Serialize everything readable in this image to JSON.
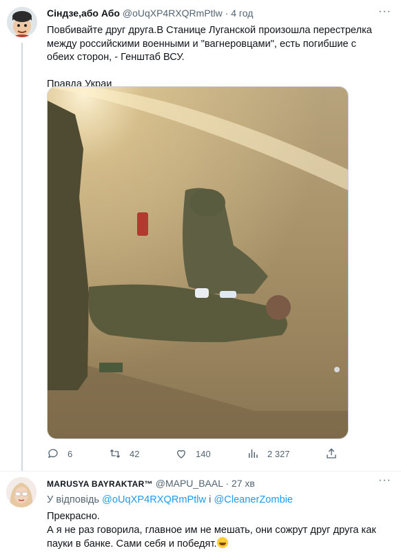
{
  "tweet1": {
    "author_name": "Сіндзе,або Або",
    "handle": "@oUqXP4RXQRmPtlw",
    "separator": "·",
    "time": "4 год",
    "more": "···",
    "text_lines": [
      "Повбивайте друг друга.В Станице Луганской произошла перестрелка",
      "между российскими военными и \"вагнеровцами\", есть погибшие с",
      "обеих сторон, - Генштаб ВСУ."
    ],
    "source_line": "Правда Украи",
    "actions": {
      "replies": "6",
      "retweets": "42",
      "likes": "140",
      "views": "2 327"
    }
  },
  "tweet2": {
    "author_name": "MARUSYA BAYRAKTAR™",
    "handle": "@MAPU_BAAL",
    "separator": "·",
    "time": "27 хв",
    "more": "···",
    "reply_prefix": "У відповідь",
    "reply_handle1": "@oUqXP4RXQRmPtlw",
    "reply_joiner": "і",
    "reply_handle2": "@CleanerZombie",
    "text_lines": [
      "Прекрасно.",
      "А я не раз говорила, главное им не мешать, они сожрут друг друга как",
      "пауки в банке. Сами себя и победят."
    ]
  },
  "colors": {
    "accent": "#1d9bf0",
    "muted": "#536471",
    "border": "#cfd9de"
  },
  "icons": [
    "reply-icon",
    "retweet-icon",
    "like-icon",
    "views-icon",
    "share-icon",
    "more-icon",
    "flag-ukraine-icon",
    "laughing-emoji-icon"
  ]
}
